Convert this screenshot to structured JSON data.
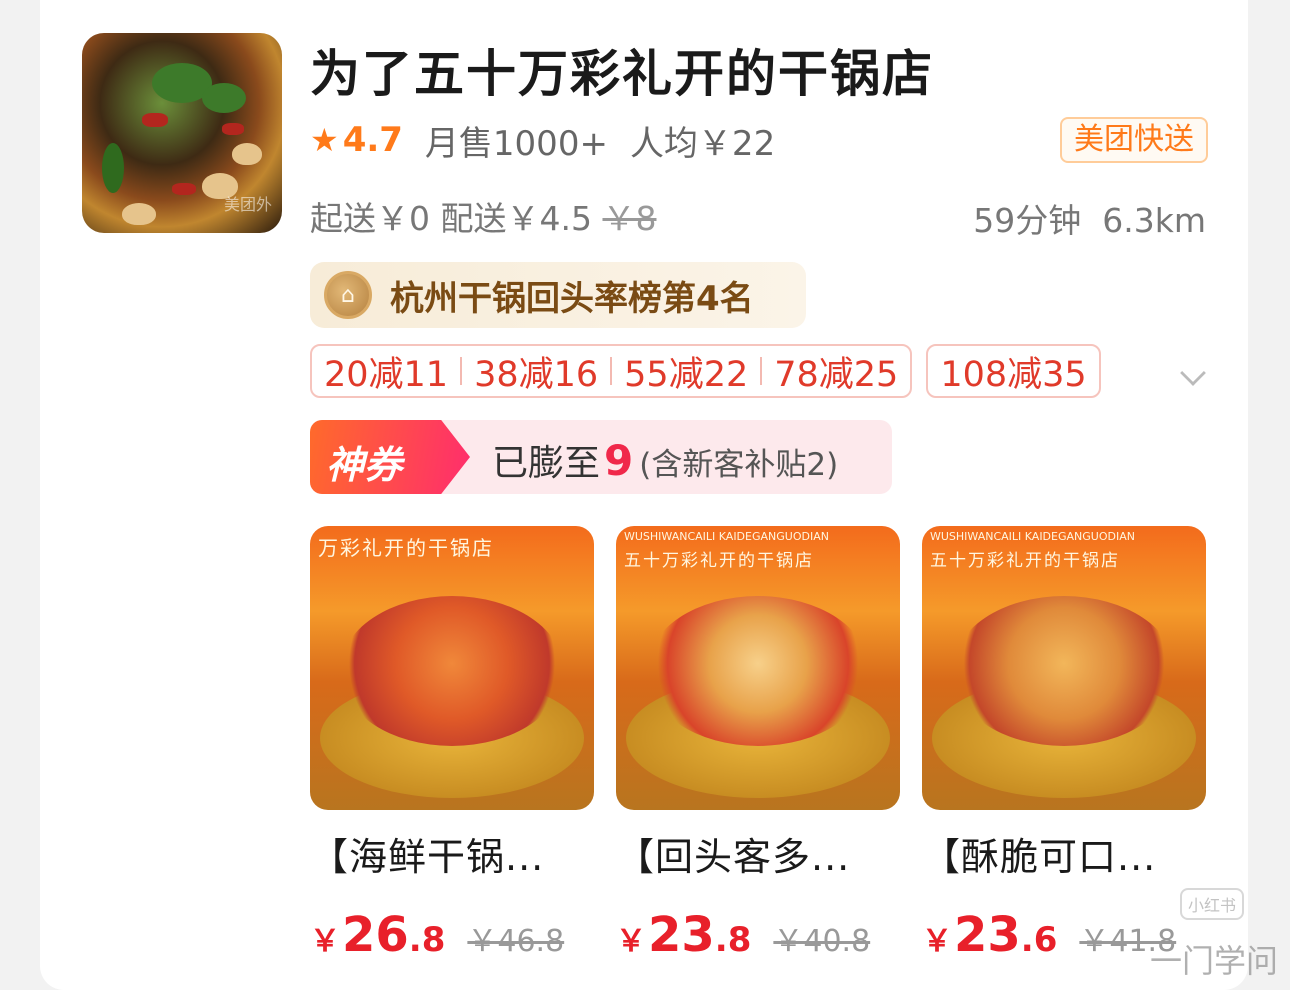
{
  "shop": {
    "name": "为了五十万彩礼开的干锅店",
    "rating": "4.7",
    "monthly_sales": "月售1000+",
    "per_capita": "人均￥22",
    "delivery_tag": "美团快送",
    "min_order": "起送￥0",
    "delivery_fee": "配送￥4.5",
    "delivery_fee_original": "￥8",
    "delivery_time": "59分钟",
    "distance": "6.3km",
    "avatar_watermark": "美团外"
  },
  "rank_badge": {
    "text": "杭州干锅回头率榜第4名"
  },
  "discounts": [
    "20减11",
    "38减16",
    "55减22",
    "78减25"
  ],
  "discount_extra": "108减35",
  "coupon": {
    "label": "神券",
    "text_prefix": "已膨至",
    "amount": "9",
    "note": "(含新客补贴2)"
  },
  "dishes": [
    {
      "name": "【海鲜干锅...",
      "price_int": "26",
      "price_dec": ".8",
      "price_old": "￥46.8",
      "brand_line": "万彩礼开的干锅店"
    },
    {
      "name": "【回头客多...",
      "price_int": "23",
      "price_dec": ".8",
      "price_old": "￥40.8",
      "brand_small": "WUSHIWANCAILI KAIDEGANGUODIAN",
      "brand_line": "五十万彩礼开的干锅店"
    },
    {
      "name": "【酥脆可口...",
      "price_int": "23",
      "price_dec": ".6",
      "price_old": "￥41.8",
      "brand_small": "WUSHIWANCAILI KAIDEGANGUODIAN",
      "brand_line": "五十万彩礼开的干锅店"
    }
  ],
  "price_symbol": "￥",
  "watermark": {
    "logo": "小红书",
    "text": "一门学问"
  },
  "colors": {
    "accent_orange": "#ff7a1a",
    "price_red": "#e8202a",
    "discount_red": "#e03a2a",
    "coupon_pink": "#f0284a"
  }
}
